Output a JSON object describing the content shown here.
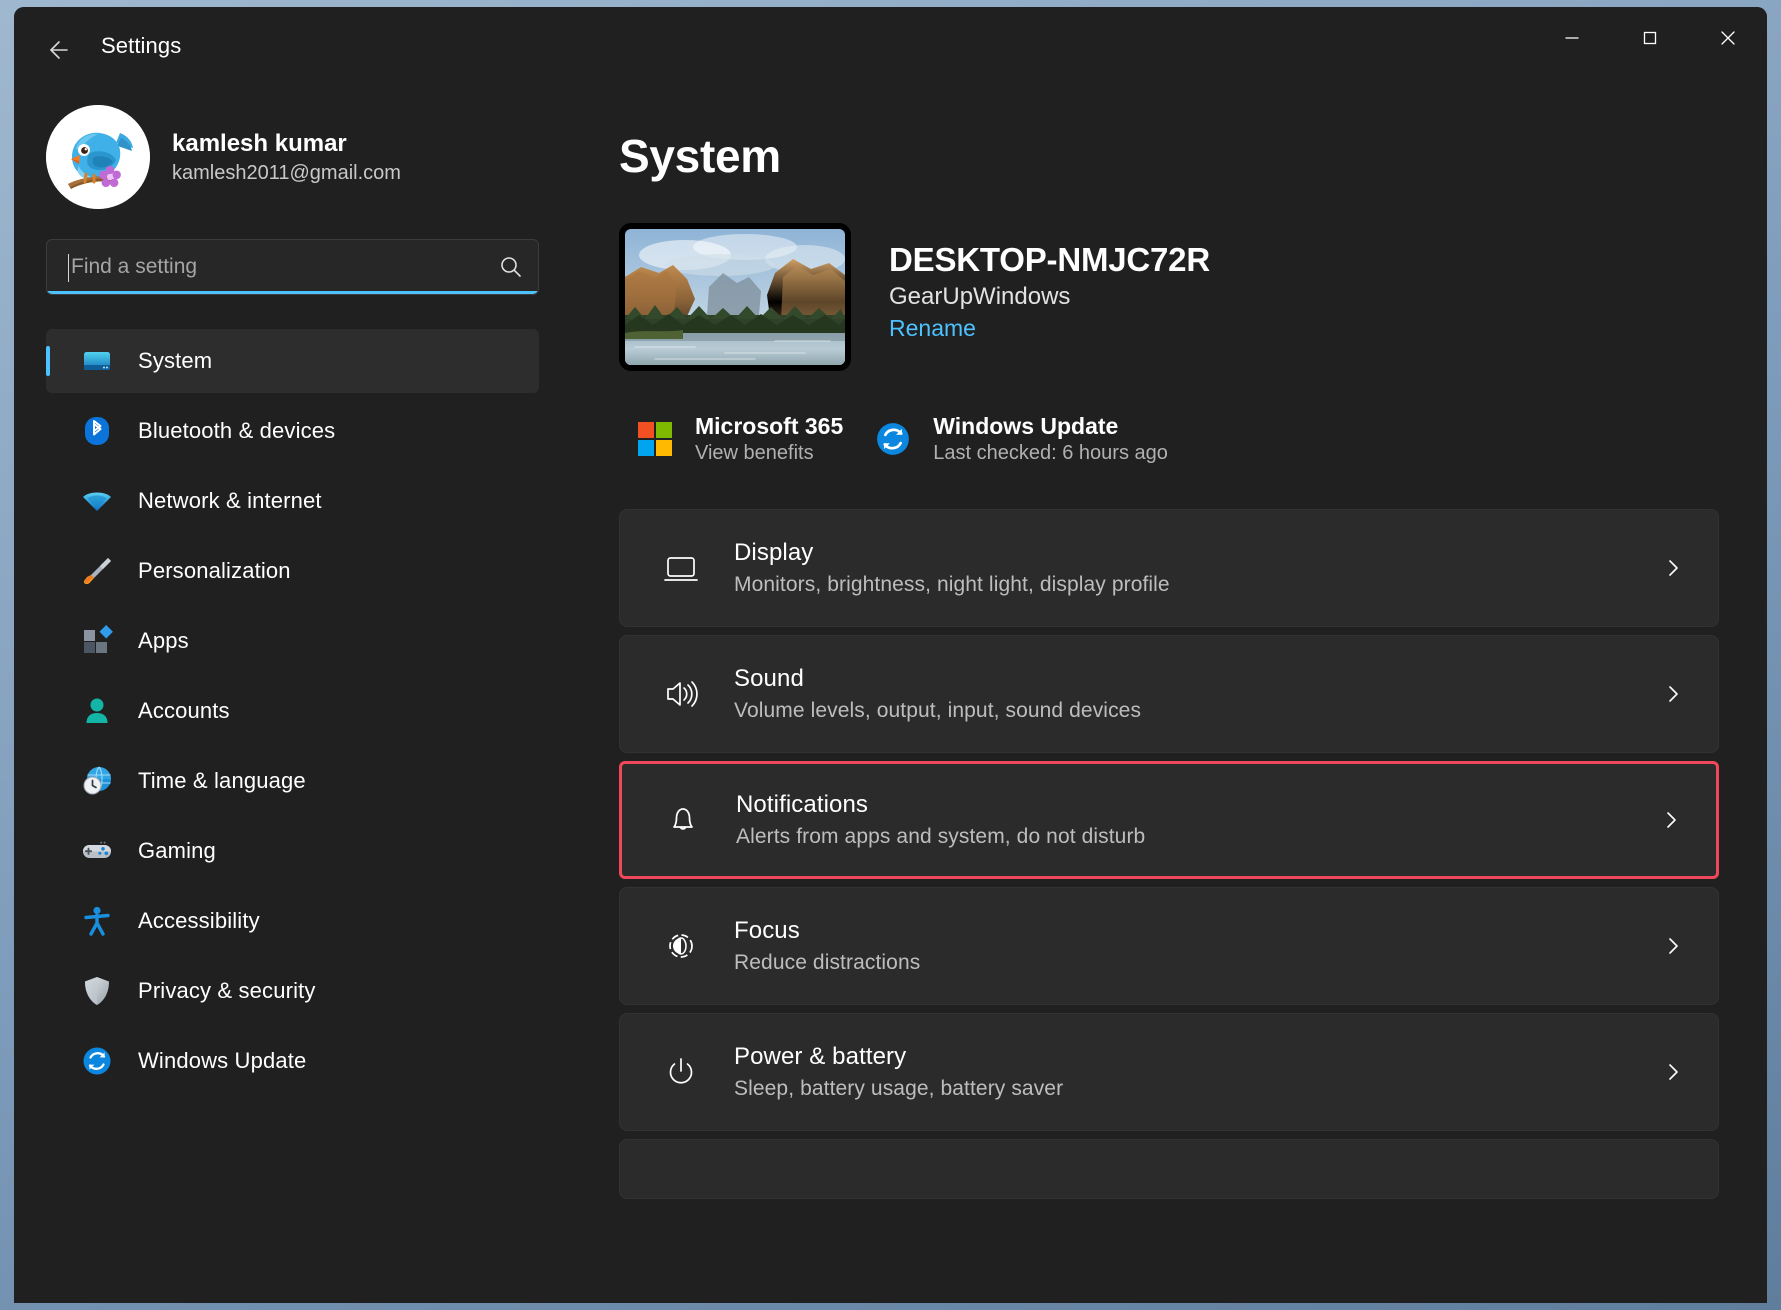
{
  "window": {
    "title": "Settings",
    "back_icon": "back-arrow-icon",
    "minimize_label": "Minimize",
    "maximize_label": "Maximize",
    "close_label": "Close"
  },
  "account": {
    "name": "kamlesh kumar",
    "email": "kamlesh2011@gmail.com",
    "avatar_icon": "bluebird-avatar"
  },
  "search": {
    "placeholder": "Find a setting",
    "value": "",
    "icon": "search-icon"
  },
  "sidebar": {
    "items": [
      {
        "label": "System",
        "icon": "system-monitor-icon",
        "selected": true
      },
      {
        "label": "Bluetooth & devices",
        "icon": "bluetooth-icon",
        "selected": false
      },
      {
        "label": "Network & internet",
        "icon": "wifi-icon",
        "selected": false
      },
      {
        "label": "Personalization",
        "icon": "paintbrush-icon",
        "selected": false
      },
      {
        "label": "Apps",
        "icon": "apps-blocks-icon",
        "selected": false
      },
      {
        "label": "Accounts",
        "icon": "person-icon",
        "selected": false
      },
      {
        "label": "Time & language",
        "icon": "clock-globe-icon",
        "selected": false
      },
      {
        "label": "Gaming",
        "icon": "gamepad-icon",
        "selected": false
      },
      {
        "label": "Accessibility",
        "icon": "accessibility-person-icon",
        "selected": false
      },
      {
        "label": "Privacy & security",
        "icon": "shield-icon",
        "selected": false
      },
      {
        "label": "Windows Update",
        "icon": "update-refresh-icon",
        "selected": false
      }
    ]
  },
  "main": {
    "page_title": "System",
    "device": {
      "name": "DESKTOP-NMJC72R",
      "subtitle": "GearUpWindows",
      "rename_label": "Rename",
      "thumbnail_icon": "desktop-wallpaper-thumbnail"
    },
    "quick_links": [
      {
        "title": "Microsoft 365",
        "subtitle": "View benefits",
        "icon": "microsoft-logo-icon"
      },
      {
        "title": "Windows Update",
        "subtitle": "Last checked: 6 hours ago",
        "icon": "update-refresh-icon"
      }
    ],
    "settings_rows": [
      {
        "title": "Display",
        "subtitle": "Monitors, brightness, night light, display profile",
        "icon": "monitor-icon",
        "highlighted": false
      },
      {
        "title": "Sound",
        "subtitle": "Volume levels, output, input, sound devices",
        "icon": "speaker-icon",
        "highlighted": false
      },
      {
        "title": "Notifications",
        "subtitle": "Alerts from apps and system, do not disturb",
        "icon": "bell-icon",
        "highlighted": true
      },
      {
        "title": "Focus",
        "subtitle": "Reduce distractions",
        "icon": "focus-moon-icon",
        "highlighted": false
      },
      {
        "title": "Power & battery",
        "subtitle": "Sleep, battery usage, battery saver",
        "icon": "power-icon",
        "highlighted": false
      }
    ],
    "chevron_icon": "chevron-right-icon"
  },
  "colors": {
    "accent": "#4cc2ff",
    "highlight_border": "#f0485b",
    "window_bg": "#202020",
    "card_bg": "#2b2b2b"
  }
}
